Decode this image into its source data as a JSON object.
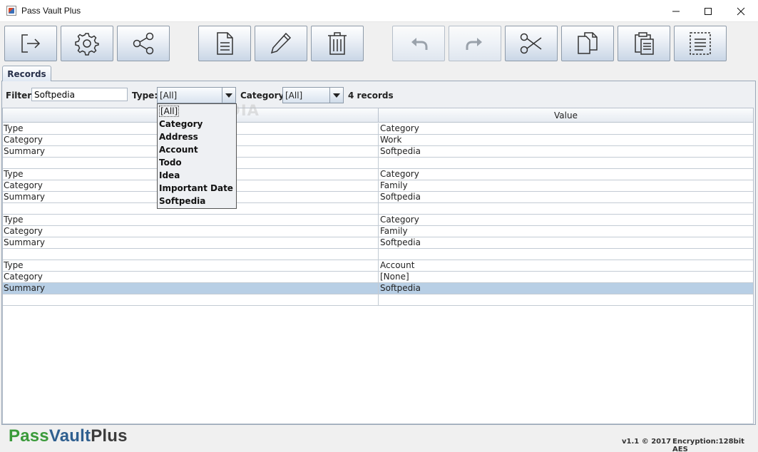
{
  "window": {
    "title": "Pass Vault Plus"
  },
  "toolbar": {
    "buttons": [
      {
        "name": "exit",
        "icon": "exit-icon"
      },
      {
        "name": "settings",
        "icon": "gear-icon"
      },
      {
        "name": "share",
        "icon": "share-icon"
      },
      {
        "name": "new",
        "icon": "new-document-icon"
      },
      {
        "name": "edit",
        "icon": "pencil-icon"
      },
      {
        "name": "delete",
        "icon": "trash-icon"
      },
      {
        "name": "undo",
        "icon": "undo-icon",
        "disabled": true
      },
      {
        "name": "redo",
        "icon": "redo-icon",
        "disabled": true
      },
      {
        "name": "cut",
        "icon": "scissors-icon"
      },
      {
        "name": "copy",
        "icon": "copy-icon"
      },
      {
        "name": "paste",
        "icon": "paste-icon"
      },
      {
        "name": "select-all",
        "icon": "select-all-icon"
      }
    ]
  },
  "tabs": [
    {
      "label": "Records",
      "active": true
    }
  ],
  "filterbar": {
    "filter_label": "Filter:",
    "filter_value": "Softpedia",
    "type_label": "Type:",
    "type_value": "[All]",
    "category_label": "Category:",
    "category_value": "[All]",
    "record_count": "4 records"
  },
  "type_dropdown": {
    "open": true,
    "options": [
      "[All]",
      "Category",
      "Address",
      "Account",
      "Todo",
      "Idea",
      "Important Date",
      "Softpedia"
    ]
  },
  "table": {
    "columns": [
      "",
      "Value"
    ],
    "rows": [
      [
        "Type",
        "Category"
      ],
      [
        "Category",
        "Work"
      ],
      [
        "Summary",
        "Softpedia"
      ],
      [
        "",
        ""
      ],
      [
        "Type",
        "Category"
      ],
      [
        "Category",
        "Family"
      ],
      [
        "Summary",
        "Softpedia"
      ],
      [
        "",
        ""
      ],
      [
        "Type",
        "Category"
      ],
      [
        "Category",
        "Family"
      ],
      [
        "Summary",
        "Softpedia"
      ],
      [
        "",
        ""
      ],
      [
        "Type",
        "Account"
      ],
      [
        "Category",
        "[None]"
      ],
      [
        "Summary",
        "Softpedia"
      ],
      [
        "",
        ""
      ]
    ],
    "selected_row": 14
  },
  "watermark": "SOFTPEDIA",
  "footer": {
    "logo_part1": "Pass",
    "logo_part2": "Vault",
    "logo_part3": "Plus",
    "version": "v1.1 © 2017",
    "encryption": "Encryption:128bit AES"
  },
  "colors": {
    "logo_green": "#3a9a3a",
    "logo_blue": "#2f5f8f",
    "logo_gray": "#3b3b3b",
    "selection": "#b8cfe5"
  }
}
